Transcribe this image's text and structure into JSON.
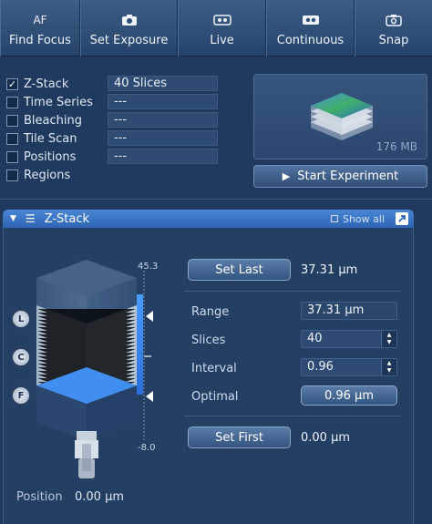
{
  "toolbar": {
    "buttons": [
      {
        "label": "Find Focus",
        "icon_text": "AF",
        "icon": "af-icon"
      },
      {
        "label": "Set Exposure",
        "icon": "camera-icon"
      },
      {
        "label": "Live",
        "icon": "live-camera-icon"
      },
      {
        "label": "Continuous",
        "icon": "continuous-camera-icon"
      },
      {
        "label": "Snap",
        "icon": "snap-camera-icon"
      }
    ]
  },
  "options": [
    {
      "label": "Z-Stack",
      "checked": true,
      "value": "40 Slices"
    },
    {
      "label": "Time Series",
      "checked": false,
      "value": "---"
    },
    {
      "label": "Bleaching",
      "checked": false,
      "value": "---"
    },
    {
      "label": "Tile Scan",
      "checked": false,
      "value": "---"
    },
    {
      "label": "Positions",
      "checked": false,
      "value": "---"
    },
    {
      "label": "Regions",
      "checked": false
    }
  ],
  "preview": {
    "size": "176 MB"
  },
  "start_button": "Start Experiment",
  "zstack": {
    "title": "Z-Stack",
    "show_all": "Show all",
    "scale_top": "45.3",
    "scale_bottom": "-8.0",
    "markers": [
      "L",
      "C",
      "F"
    ],
    "position_label": "Position",
    "position_value": "0.00 µm",
    "set_last": "Set Last",
    "set_last_value": "37.31 µm",
    "range_label": "Range",
    "range_value": "37.31 µm",
    "slices_label": "Slices",
    "slices_value": "40",
    "interval_label": "Interval",
    "interval_value": "0.96",
    "optimal_label": "Optimal",
    "optimal_value": "0.96 µm",
    "set_first": "Set First",
    "set_first_value": "0.00 µm"
  },
  "colors": {
    "background": "#1f3a5e",
    "header_accent": "#3a78c9",
    "stack_highlight": "#3f8ef0"
  }
}
